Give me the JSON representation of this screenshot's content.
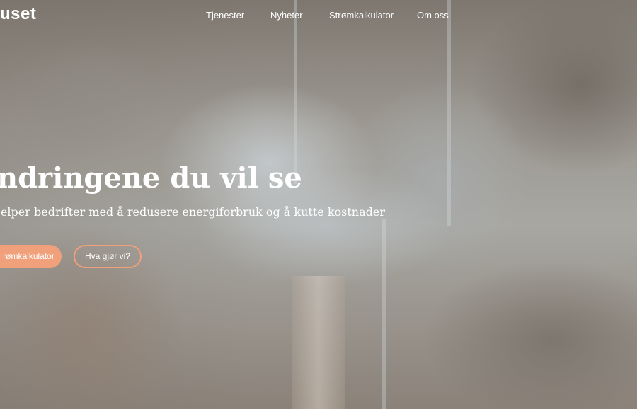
{
  "brand": {
    "logo_text": "uset"
  },
  "nav": {
    "items": [
      {
        "label": "Tjenester"
      },
      {
        "label": "Nyheter"
      },
      {
        "label": "Strømkalkulator"
      },
      {
        "label": "Om oss"
      }
    ]
  },
  "hero": {
    "headline": "ndringene du vil se",
    "subline": "jelper bedrifter med å redusere energiforbruk og å kutte kostnader",
    "primary_button": "rømkalkulator",
    "secondary_button": "Hva gjør vi?"
  },
  "colors": {
    "accent": "#f0a07a",
    "text": "#ffffff"
  },
  "icons": []
}
